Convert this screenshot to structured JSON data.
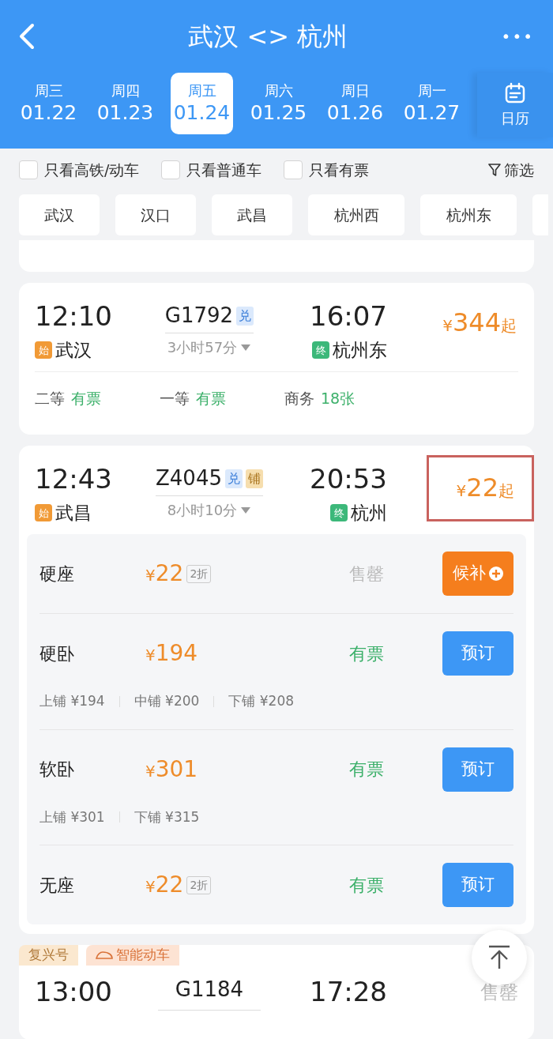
{
  "header": {
    "title": "武汉 <> 杭州",
    "more": "•••"
  },
  "dates": [
    {
      "weekday": "周三",
      "date": "01.22",
      "selected": false
    },
    {
      "weekday": "周四",
      "date": "01.23",
      "selected": false
    },
    {
      "weekday": "周五",
      "date": "01.24",
      "selected": true
    },
    {
      "weekday": "周六",
      "date": "01.25",
      "selected": false
    },
    {
      "weekday": "周日",
      "date": "01.26",
      "selected": false
    },
    {
      "weekday": "周一",
      "date": "01.27",
      "selected": false
    }
  ],
  "calendar": {
    "label": "日历"
  },
  "filters": [
    {
      "label": "只看高铁/动车",
      "checked": false
    },
    {
      "label": "只看普通车",
      "checked": false
    },
    {
      "label": "只看有票",
      "checked": false
    }
  ],
  "filter_button": {
    "label": "筛选"
  },
  "stations": [
    "武汉",
    "汉口",
    "武昌",
    "杭州西",
    "杭州东"
  ],
  "trains": [
    {
      "depart_time": "12:10",
      "train_no": "G1792",
      "tags": [
        {
          "label": "兑",
          "kind": "exchange"
        }
      ],
      "arrive_time": "16:07",
      "from": {
        "badge": "始",
        "name": "武汉"
      },
      "to": {
        "badge": "终",
        "name": "杭州东"
      },
      "duration": "3小时57分",
      "price": {
        "currency": "¥",
        "amount": "344",
        "suffix": "起"
      },
      "highlighted": false,
      "expanded": false,
      "seats": [
        {
          "class": "二等",
          "availability": "有票"
        },
        {
          "class": "一等",
          "availability": "有票"
        },
        {
          "class": "商务",
          "availability": "18张"
        }
      ]
    },
    {
      "depart_time": "12:43",
      "train_no": "Z4045",
      "tags": [
        {
          "label": "兑",
          "kind": "exchange"
        },
        {
          "label": "铺",
          "kind": "berth"
        }
      ],
      "arrive_time": "20:53",
      "from": {
        "badge": "始",
        "name": "武昌"
      },
      "to": {
        "badge": "终",
        "name": "杭州"
      },
      "duration": "8小时10分",
      "price": {
        "currency": "¥",
        "amount": "22",
        "suffix": "起"
      },
      "highlighted": true,
      "expanded": true,
      "seat_options": [
        {
          "name": "硬座",
          "currency": "¥",
          "price": "22",
          "discount": "2折",
          "status": "售罄",
          "sold_out": true,
          "action": {
            "label": "候补",
            "kind": "waitlist"
          }
        },
        {
          "name": "硬卧",
          "currency": "¥",
          "price": "194",
          "status": "有票",
          "sold_out": false,
          "action": {
            "label": "预订",
            "kind": "book"
          },
          "berths": [
            "上铺 ¥194",
            "中铺 ¥200",
            "下铺 ¥208"
          ]
        },
        {
          "name": "软卧",
          "currency": "¥",
          "price": "301",
          "status": "有票",
          "sold_out": false,
          "action": {
            "label": "预订",
            "kind": "book"
          },
          "berths": [
            "上铺 ¥301",
            "下铺 ¥315"
          ]
        },
        {
          "name": "无座",
          "currency": "¥",
          "price": "22",
          "discount": "2折",
          "status": "有票",
          "sold_out": false,
          "action": {
            "label": "预订",
            "kind": "book"
          }
        }
      ]
    }
  ],
  "next_train": {
    "labels": [
      {
        "label": "复兴号",
        "kind": "plain"
      },
      {
        "label": "智能动车",
        "kind": "smart"
      }
    ],
    "depart_time": "13:00",
    "train_no": "G1184",
    "arrive_time": "17:28",
    "status": "售罄"
  }
}
